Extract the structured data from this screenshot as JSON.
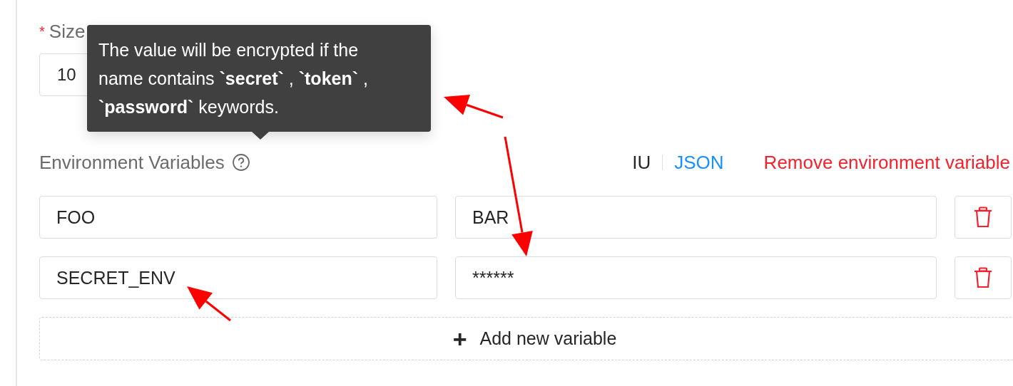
{
  "size_field": {
    "label": "Size",
    "required_mark": "*",
    "value": "10"
  },
  "env_section": {
    "label": "Environment Variables",
    "tooltip": "The value will be encrypted if the name contains **`secret`** , **`token`** , **`password`** keywords.",
    "modes": [
      {
        "label": "IU",
        "selected": true
      },
      {
        "label": "JSON",
        "selected": false
      }
    ],
    "remove_link": "Remove environment variable",
    "variables": [
      {
        "name": "FOO",
        "value": "BAR"
      },
      {
        "name": "SECRET_ENV",
        "value": "******"
      }
    ],
    "add_button": {
      "icon": "+",
      "label": "Add new variable"
    }
  }
}
